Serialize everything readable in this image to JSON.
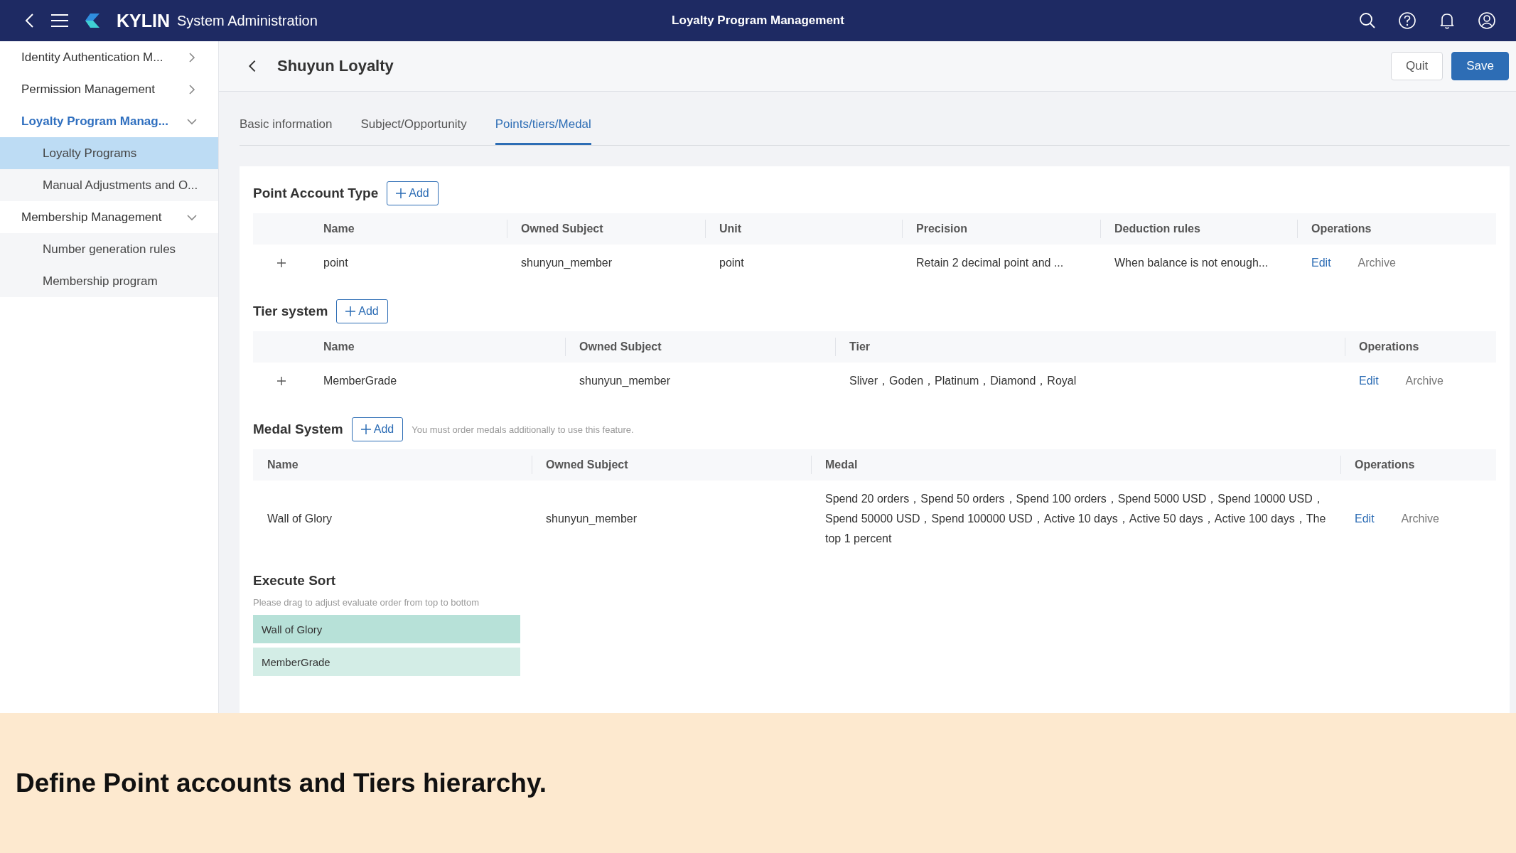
{
  "header": {
    "brand": "KYLIN",
    "app_name": "System Administration",
    "page_title": "Loyalty Program Management"
  },
  "sidebar": {
    "items": [
      {
        "label": "Identity Authentication M...",
        "expanded": false,
        "active": false
      },
      {
        "label": "Permission Management",
        "expanded": false,
        "active": false
      },
      {
        "label": "Loyalty Program Manag...",
        "expanded": true,
        "active": true,
        "children": [
          {
            "label": "Loyalty Programs",
            "selected": true
          },
          {
            "label": "Manual Adjustments and O...",
            "selected": false
          }
        ]
      },
      {
        "label": "Membership Management",
        "expanded": true,
        "active": false,
        "children": [
          {
            "label": "Number generation rules",
            "selected": false
          },
          {
            "label": "Membership program",
            "selected": false
          }
        ]
      }
    ]
  },
  "page": {
    "title": "Shuyun Loyalty",
    "buttons": [
      {
        "label": "Quit",
        "kind": "default"
      },
      {
        "label": "Save",
        "kind": "primary"
      }
    ]
  },
  "tabs": [
    {
      "label": "Basic information",
      "selected": false
    },
    {
      "label": "Subject/Opportunity",
      "selected": false
    },
    {
      "label": "Points/tiers/Medal",
      "selected": true
    }
  ],
  "sections": [
    {
      "title": "Point Account Type",
      "add_label": "Add",
      "expandable": true,
      "columns": [
        "Name",
        "Owned Subject",
        "Unit",
        "Precision",
        "Deduction rules",
        "Operations"
      ],
      "rows": [
        {
          "cells": [
            "point",
            "shunyun_member",
            "point",
            "Retain 2 decimal point and ...",
            "When balance is not enough..."
          ],
          "operations": [
            {
              "label": "Edit",
              "kind": "link"
            },
            {
              "label": "Archive",
              "kind": "muted"
            }
          ]
        }
      ]
    },
    {
      "title": "Tier system",
      "add_label": "Add",
      "expandable": true,
      "columns": [
        "Name",
        "Owned Subject",
        "Tier",
        "Operations"
      ],
      "rows": [
        {
          "cells": [
            "MemberGrade",
            "shunyun_member",
            "Sliver，Goden，Platinum，Diamond，Royal"
          ],
          "operations": [
            {
              "label": "Edit",
              "kind": "link"
            },
            {
              "label": "Archive",
              "kind": "muted"
            }
          ]
        }
      ]
    },
    {
      "title": "Medal System",
      "add_label": "Add",
      "note": "You must order medals additionally to use this feature.",
      "expandable": false,
      "columns": [
        "Name",
        "Owned Subject",
        "Medal",
        "Operations"
      ],
      "rows": [
        {
          "cells": [
            "Wall of Glory",
            "shunyun_member",
            "Spend 20 orders，Spend 50 orders，Spend 100 orders，Spend 5000 USD，Spend 10000 USD，Spend 50000 USD，Spend 100000 USD，Active 10 days，Active 50 days，Active 100 days，The top 1 percent"
          ],
          "operations": [
            {
              "label": "Edit",
              "kind": "link"
            },
            {
              "label": "Archive",
              "kind": "muted"
            }
          ]
        }
      ]
    }
  ],
  "execute_sort": {
    "title": "Execute Sort",
    "hint": "Please drag to adjust evaluate order from top to bottom",
    "items": [
      {
        "label": "Wall of Glory",
        "color": "#b7e1d8"
      },
      {
        "label": "MemberGrade",
        "color": "#d3ede6"
      }
    ]
  },
  "caption": "Define Point accounts and Tiers hierarchy."
}
